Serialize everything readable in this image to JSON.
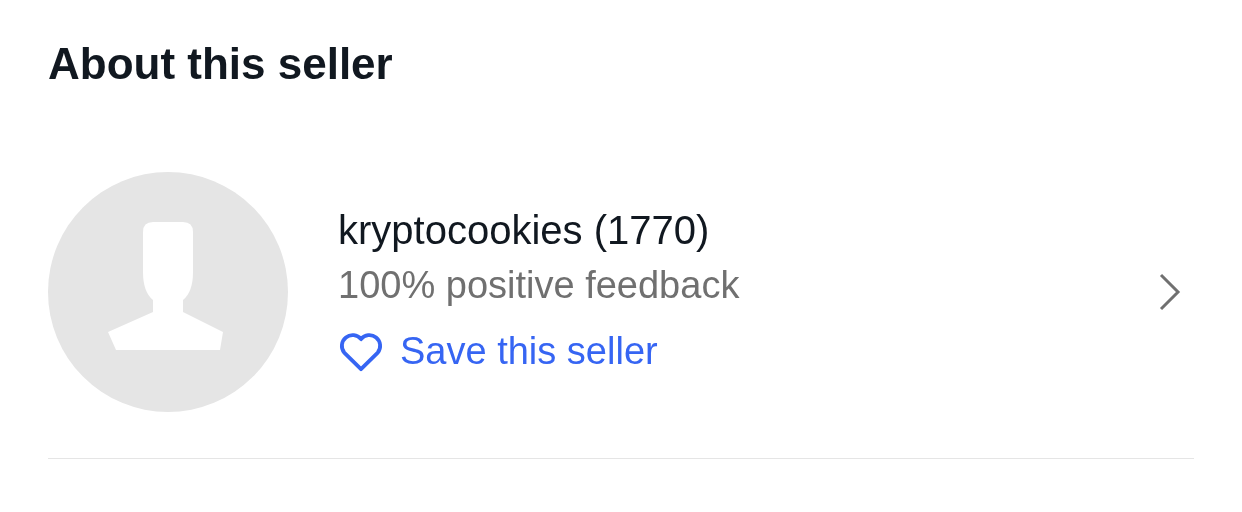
{
  "title": "About this seller",
  "seller": {
    "name": "kryptocookies (1770)",
    "feedback": "100% positive feedback",
    "save_label": "Save this seller",
    "saved": false
  }
}
